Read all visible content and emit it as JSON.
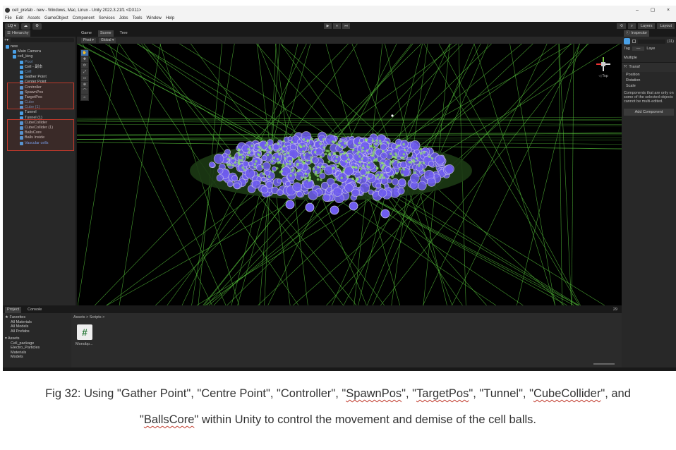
{
  "window": {
    "title": "cell_prefab - new - Windows, Mac, Linux - Unity 2022.3.21f1 <DX11>",
    "controls": [
      "–",
      "▢",
      "×"
    ]
  },
  "menu": [
    "File",
    "Edit",
    "Assets",
    "GameObject",
    "Component",
    "Services",
    "Jobs",
    "Tools",
    "Window",
    "Help"
  ],
  "toolbar": {
    "account": "LQ ▾",
    "play": "▶",
    "pause": "⏸",
    "step": "⏭",
    "layers": "Layers",
    "layout": "Layout"
  },
  "hierarchy": {
    "tab": "Hierarchy",
    "items": [
      {
        "label": "new",
        "depth": 0
      },
      {
        "label": "Main Camera",
        "depth": 1
      },
      {
        "label": "cell_king",
        "depth": 1
      },
      {
        "label": "Pool",
        "depth": 2
      },
      {
        "label": "Cell - 副本",
        "depth": 2
      },
      {
        "label": "Cell",
        "depth": 2
      },
      {
        "label": "Gather Point",
        "depth": 2
      },
      {
        "label": "Center Point",
        "depth": 2
      },
      {
        "label": "Controller",
        "depth": 2
      },
      {
        "label": "SpawnPos",
        "depth": 2
      },
      {
        "label": "TargetPos",
        "depth": 2
      },
      {
        "label": "Cube",
        "depth": 2
      },
      {
        "label": "Cube (1)",
        "depth": 2
      },
      {
        "label": "Tunnel",
        "depth": 2
      },
      {
        "label": "Tunnel (1)",
        "depth": 2
      },
      {
        "label": "CubeCollider",
        "depth": 2
      },
      {
        "label": "CubeCollider (1)",
        "depth": 2
      },
      {
        "label": "BallsCore",
        "depth": 2
      },
      {
        "label": "Balls Inside",
        "depth": 2
      },
      {
        "label": "Vascular cells",
        "depth": 2
      }
    ]
  },
  "scene": {
    "tabs": [
      "Game",
      "Scene",
      "Tree"
    ],
    "tools": [
      "Pivot ▾",
      "Global ▾"
    ],
    "gizmo_label": "◁ Top",
    "side_tools": [
      "✋",
      "✥",
      "⟳",
      "⤢",
      "▭",
      "⊕",
      "⌒",
      "⌂"
    ]
  },
  "inspector": {
    "tab": "Inspector",
    "count": "(11)",
    "tag_label": "Tag",
    "tag_value": "—",
    "layer_label": "Laye",
    "multiple": "Multiple",
    "component": "Transf",
    "position": "Position",
    "rotation": "Rotation",
    "scale": "Scale",
    "note": "Components that are only on some of the selected objects cannot be multi-edited.",
    "add_button": "Add Component"
  },
  "project": {
    "tabs": [
      "Project",
      "Console"
    ],
    "favorites": "Favorites",
    "favorite_items": [
      "All Materials",
      "All Models",
      "All Prefabs"
    ],
    "assets": "Assets",
    "asset_items": [
      "Cell_package",
      "Electro_Particles",
      "Materials",
      "Models"
    ],
    "breadcrumb": "Assets > Scripts >",
    "script_name": "Monobp...",
    "count": "29"
  },
  "caption": {
    "line1_parts": [
      "Fig 32: Using \"Gather Point\", \"Centre Point\", \"Controller\", \"",
      "SpawnPos",
      "\", \"",
      "TargetPos",
      "\", \"Tunnel\", \"",
      "CubeCollider",
      "\", and"
    ],
    "line2_parts": [
      "\"",
      "BallsCore",
      "\" within Unity to control the movement and demise of the cell balls."
    ]
  },
  "colors": {
    "accent": "#3d6fa8",
    "highlight_box": "#c0392b",
    "wire": "#56c33b",
    "balls": "#6f5cf0"
  }
}
